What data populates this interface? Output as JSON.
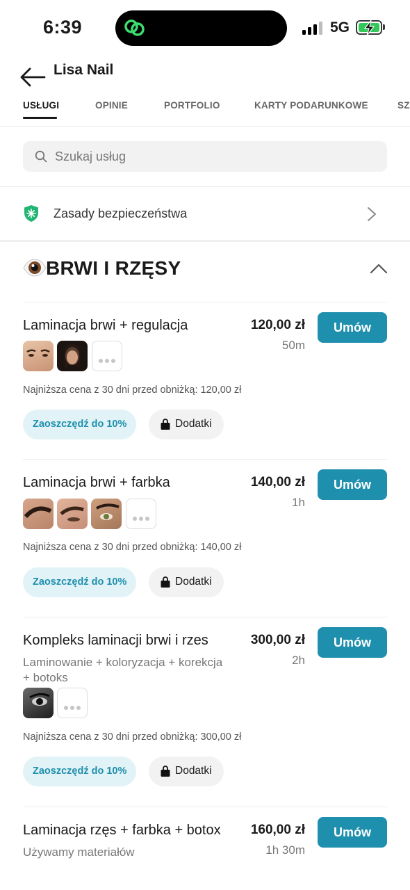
{
  "status": {
    "time": "6:39",
    "network": "5G"
  },
  "header": {
    "title": "Lisa Nail"
  },
  "tabs": [
    {
      "label": "USŁUGI"
    },
    {
      "label": "OPINIE"
    },
    {
      "label": "PORTFOLIO"
    },
    {
      "label": "KARTY PODARUNKOWE"
    },
    {
      "label": "SZ"
    }
  ],
  "search": {
    "placeholder": "Szukaj usług"
  },
  "safety": {
    "label": "Zasady bezpieczeństwa"
  },
  "category": {
    "emoji": "👁️",
    "title": "BRWI I RZĘSY"
  },
  "labels": {
    "book": "Umów",
    "save": "Zaoszczędź do 10%",
    "extras": "Dodatki"
  },
  "services": [
    {
      "name": "Laminacja brwi + regulacja",
      "price": "120,00 zł",
      "duration": "50m",
      "lowest": "Najniższa cena z 30 dni przed obniżką: 120,00 zł"
    },
    {
      "name": "Laminacja brwi + farbka",
      "price": "140,00 zł",
      "duration": "1h",
      "lowest": "Najniższa cena z 30 dni przed obniżką: 140,00 zł"
    },
    {
      "name": "Kompleks laminacji brwi i rzes",
      "description": "Laminowanie + koloryzacja + korekcja + botoks",
      "price": "300,00 zł",
      "duration": "2h",
      "lowest": "Najniższa cena z 30 dni przed obniżką: 300,00 zł"
    },
    {
      "name": "Laminacja rzęs + farbka + botox",
      "description": "Używamy materiałów",
      "price": "160,00 zł",
      "duration": "1h 30m"
    }
  ],
  "colors": {
    "accent": "#1f8fae",
    "chip_bg": "#e1f3f6",
    "battery": "#33c759",
    "shield": "#22b573"
  }
}
